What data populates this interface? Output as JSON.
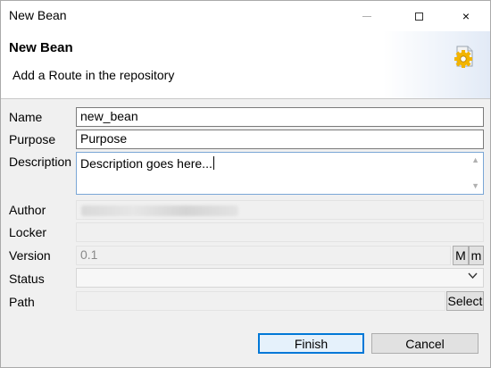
{
  "window": {
    "title": "New Bean",
    "minimize_glyph": "",
    "close_glyph": "×"
  },
  "banner": {
    "title": "New Bean",
    "subtitle": "Add a Route in the repository",
    "icon": "bean-gear-icon"
  },
  "form": {
    "name": {
      "label": "Name",
      "value": "new_bean"
    },
    "purpose": {
      "label": "Purpose",
      "value": "Purpose"
    },
    "description": {
      "label": "Description",
      "value": "Description goes here..."
    },
    "author": {
      "label": "Author",
      "value": ""
    },
    "locker": {
      "label": "Locker",
      "value": ""
    },
    "version": {
      "label": "Version",
      "value": "0.1",
      "major_button": "M",
      "minor_button": "m"
    },
    "status": {
      "label": "Status",
      "value": ""
    },
    "path": {
      "label": "Path",
      "value": "",
      "select_button": "Select"
    }
  },
  "buttons": {
    "finish": "Finish",
    "cancel": "Cancel"
  },
  "colors": {
    "focus_border": "#7aa6d6",
    "default_button_border": "#0078d7"
  }
}
